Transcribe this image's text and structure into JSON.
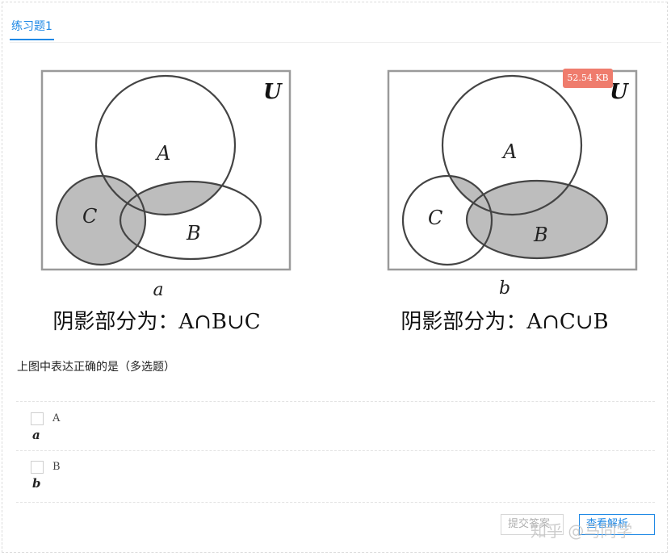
{
  "tab": {
    "label": "练习题1"
  },
  "figures": [
    {
      "universe_label": "U",
      "set_labels": {
        "A": "A",
        "B": "B",
        "C": "C"
      },
      "caption": "a",
      "formula": "阴影部分为：A∩B∪C"
    },
    {
      "universe_label": "U",
      "set_labels": {
        "A": "A",
        "B": "B",
        "C": "C"
      },
      "caption": "b",
      "formula": "阴影部分为：A∩C∪B"
    }
  ],
  "size_badge": "52.54 KB",
  "question": "上图中表达正确的是（多选题）",
  "options": [
    {
      "letter": "A",
      "text": "a",
      "checked": false
    },
    {
      "letter": "B",
      "text": "b",
      "checked": false
    }
  ],
  "buttons": {
    "submit": "提交答案",
    "view_solution": "查看解析"
  },
  "watermark": "知乎 @马同学",
  "colors": {
    "accent": "#1e88e5",
    "shade": "#bdbdbd",
    "badge": "#ef7c6d"
  }
}
